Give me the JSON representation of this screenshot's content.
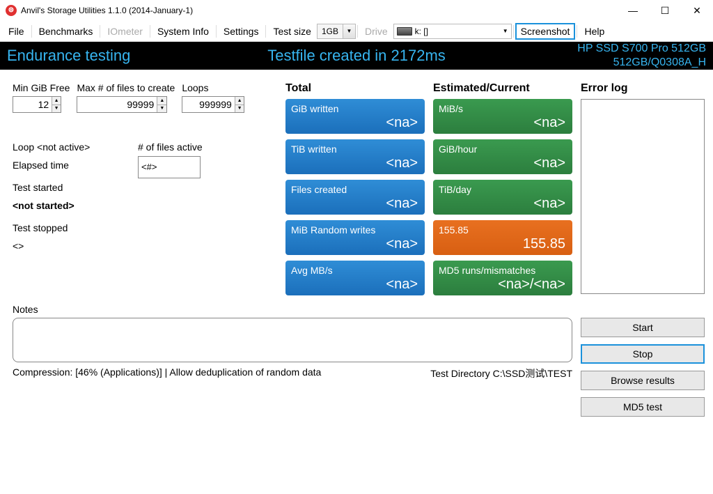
{
  "window": {
    "title": "Anvil's Storage Utilities 1.1.0 (2014-January-1)"
  },
  "menu": {
    "file": "File",
    "benchmarks": "Benchmarks",
    "iometer": "IOmeter",
    "systeminfo": "System Info",
    "settings": "Settings",
    "testsize": "Test size",
    "testsize_val": "1GB",
    "drive": "Drive",
    "drive_val": "k: []",
    "screenshot": "Screenshot",
    "help": "Help"
  },
  "banner": {
    "left": "Endurance testing",
    "mid": "Testfile created in 2172ms",
    "r1": "HP SSD S700 Pro 512GB",
    "r2": "512GB/Q0308A_H"
  },
  "inputs": {
    "mingib_lab": "Min GiB Free",
    "mingib_val": "12",
    "maxfiles_lab": "Max # of files to create",
    "maxfiles_val": "99999",
    "loops_lab": "Loops",
    "loops_val": "999999"
  },
  "status": {
    "loop": "Loop <not active>",
    "filesact_lab": "# of files active",
    "filesact_val": "<#>",
    "elapsed": "Elapsed time",
    "started_lab": "Test started",
    "started_val": "<not started>",
    "stopped_lab": "Test stopped",
    "stopped_val": "<>"
  },
  "total": {
    "head": "Total",
    "gib_lab": "GiB written",
    "gib_val": "<na>",
    "tib_lab": "TiB written",
    "tib_val": "<na>",
    "files_lab": "Files created",
    "files_val": "<na>",
    "mibrw_lab": "MiB Random writes",
    "mibrw_val": "<na>",
    "avgmb_lab": "Avg MB/s",
    "avgmb_val": "<na>"
  },
  "est": {
    "head": "Estimated/Current",
    "mibs_lab": "MiB/s",
    "mibs_val": "<na>",
    "gibh_lab": "GiB/hour",
    "gibh_val": "<na>",
    "tibd_lab": "TiB/day",
    "tibd_val": "<na>",
    "n_lab": "155.85",
    "n_val": "155.85",
    "md5_lab": "MD5 runs/mismatches",
    "md5_val": "<na>/<na>"
  },
  "errorlog": {
    "head": "Error log"
  },
  "notes": {
    "label": "Notes",
    "compression": "Compression: [46% (Applications)] | Allow deduplication of random data",
    "testdir": "Test Directory C:\\SSD测试\\TEST"
  },
  "buttons": {
    "start": "Start",
    "stop": "Stop",
    "browse": "Browse results",
    "md5": "MD5 test"
  }
}
